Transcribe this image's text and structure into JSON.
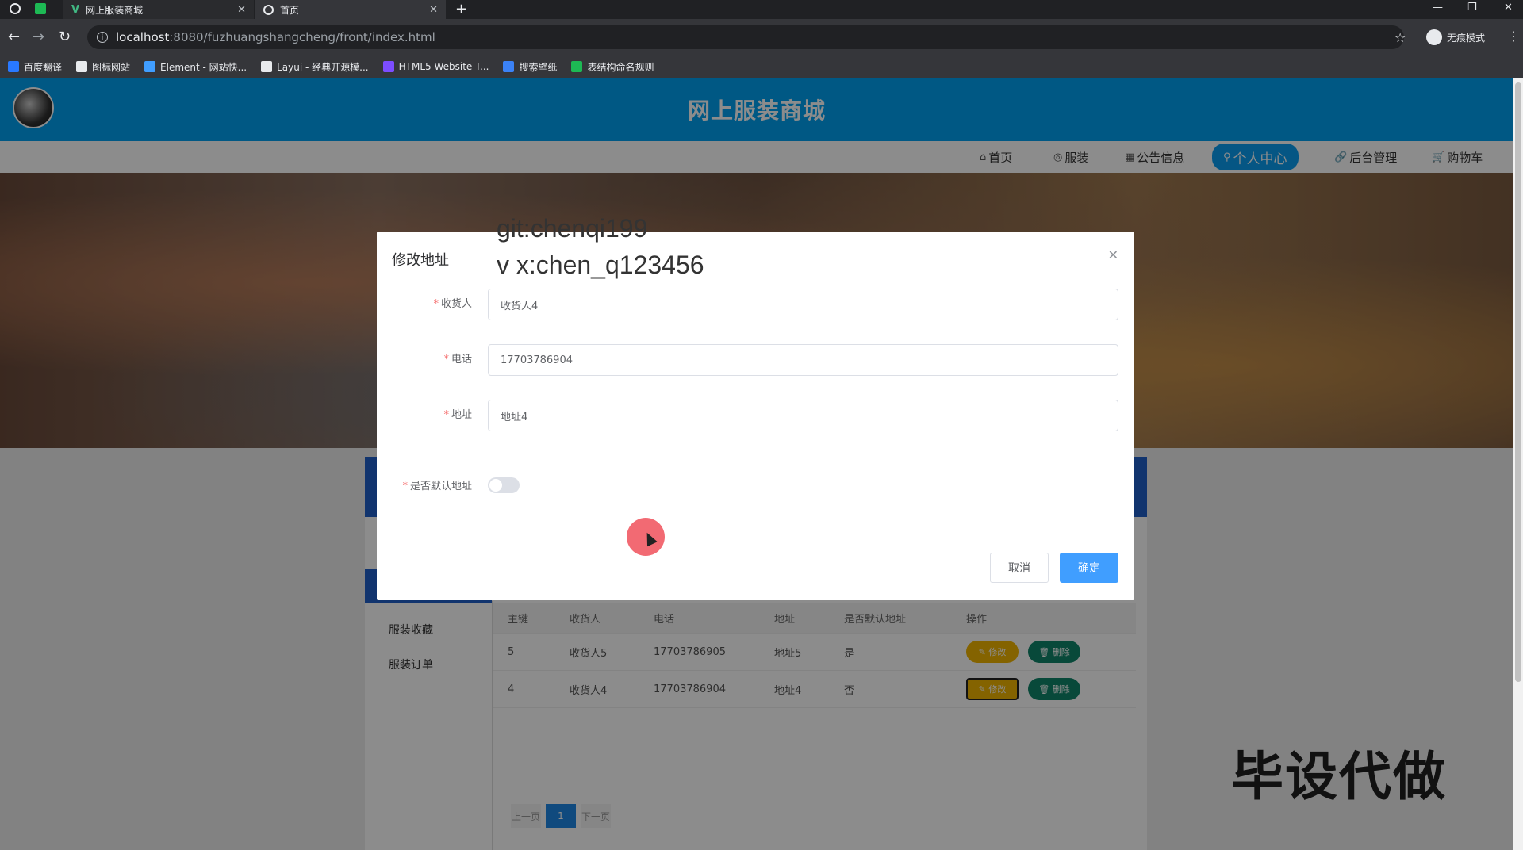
{
  "browser": {
    "tabs": [
      {
        "title": "网上服装商城"
      },
      {
        "title": "首页"
      }
    ],
    "url_host": "localhost",
    "url_path": ":8080/fuzhuangshangcheng/front/index.html",
    "profile_label": "无痕模式",
    "bookmarks": [
      {
        "label": "百度翻译",
        "color": "#2979ff"
      },
      {
        "label": "图标网站",
        "color": "#e8eaed"
      },
      {
        "label": "Element - 网站快...",
        "color": "#409eff"
      },
      {
        "label": "Layui - 经典开源模...",
        "color": "#e8eaed"
      },
      {
        "label": "HTML5 Website T...",
        "color": "#7c4dff"
      },
      {
        "label": "搜索壁纸",
        "color": "#3b82f6"
      },
      {
        "label": "表结构命名规则",
        "color": "#1db954"
      }
    ]
  },
  "site": {
    "title": "网上服装商城",
    "nav": [
      {
        "label": "首页",
        "icon": "home-icon",
        "glyph": "⌂"
      },
      {
        "label": "服装",
        "icon": "compass-icon",
        "glyph": "◎"
      },
      {
        "label": "公告信息",
        "icon": "grid-icon",
        "glyph": "▦"
      },
      {
        "label": "个人中心",
        "icon": "user-icon",
        "glyph": "⚲",
        "active": true
      },
      {
        "label": "后台管理",
        "icon": "link-icon",
        "glyph": "🔗"
      },
      {
        "label": "购物车",
        "icon": "cart-icon",
        "glyph": "🛒"
      }
    ],
    "accent": "#00a0f0"
  },
  "side_menu": [
    "服装收藏",
    "服装订单"
  ],
  "table": {
    "headers": [
      "主键",
      "收货人",
      "电话",
      "地址",
      "是否默认地址",
      "操作"
    ],
    "rows": [
      {
        "id": "5",
        "name": "收货人5",
        "phone": "17703786905",
        "address": "地址5",
        "default": "是"
      },
      {
        "id": "4",
        "name": "收货人4",
        "phone": "17703786904",
        "address": "地址4",
        "default": "否"
      }
    ],
    "edit_label": "修改",
    "delete_label": "删除"
  },
  "pager": {
    "prev": "上一页",
    "current": "1",
    "next": "下一页"
  },
  "dialog": {
    "title": "修改地址",
    "fields": [
      {
        "label": "收货人",
        "value": "收货人4"
      },
      {
        "label": "电话",
        "value": "17703786904"
      },
      {
        "label": "地址",
        "value": "地址4"
      }
    ],
    "switch_label": "是否默认地址",
    "switch_on": false,
    "cancel": "取消",
    "confirm": "确定"
  },
  "overlay_text": {
    "line1": "git:chenqi199",
    "line2": "v x:chen_q123456"
  },
  "watermark": "毕设代做"
}
